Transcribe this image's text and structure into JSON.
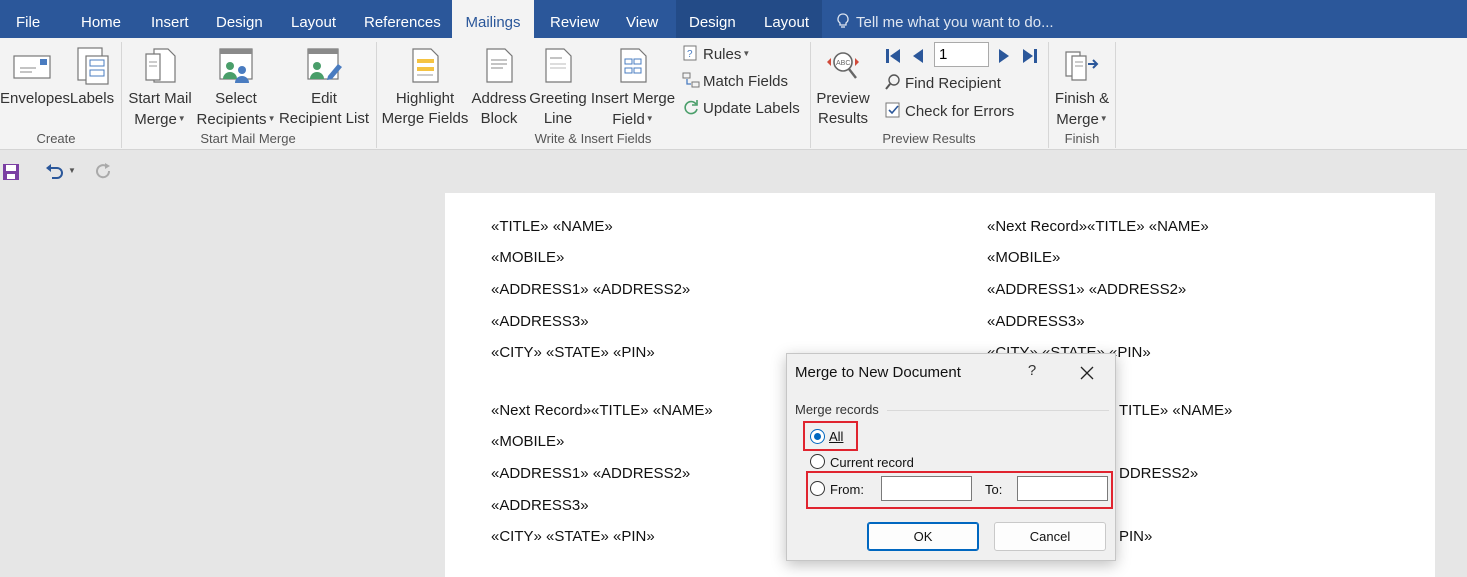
{
  "tabs": {
    "file": "File",
    "home": "Home",
    "insert": "Insert",
    "design": "Design",
    "layout": "Layout",
    "references": "References",
    "mailings": "Mailings",
    "review": "Review",
    "view": "View",
    "ctx_design": "Design",
    "ctx_layout": "Layout",
    "tell_me": "Tell me what you want to do..."
  },
  "ribbon": {
    "create": {
      "envelopes": "Envelopes",
      "labels": "Labels",
      "group": "Create"
    },
    "start_mail_merge": {
      "start_line1": "Start Mail",
      "start_line2": "Merge",
      "select_line1": "Select",
      "select_line2": "Recipients",
      "edit_line1": "Edit",
      "edit_line2": "Recipient List",
      "group": "Start Mail Merge"
    },
    "write_insert": {
      "highlight_line1": "Highlight",
      "highlight_line2": "Merge Fields",
      "address_line1": "Address",
      "address_line2": "Block",
      "greeting_line1": "Greeting",
      "greeting_line2": "Line",
      "insert_line1": "Insert Merge",
      "insert_line2": "Field",
      "rules": "Rules",
      "match_fields": "Match Fields",
      "update_labels": "Update Labels",
      "group": "Write & Insert Fields"
    },
    "preview": {
      "preview_line1": "Preview",
      "preview_line2": "Results",
      "record_number": "1",
      "find_recipient": "Find Recipient",
      "check_errors": "Check for Errors",
      "group": "Preview Results"
    },
    "finish": {
      "finish_line1": "Finish &",
      "finish_line2": "Merge",
      "group": "Finish"
    }
  },
  "document": {
    "left_block1": [
      "«TITLE» «NAME»",
      "«MOBILE»",
      "«ADDRESS1» «ADDRESS2»",
      "«ADDRESS3»",
      "«CITY» «STATE» «PIN»"
    ],
    "left_block2": [
      "«Next Record»«TITLE» «NAME»",
      "«MOBILE»",
      "«ADDRESS1» «ADDRESS2»",
      "«ADDRESS3»",
      "«CITY» «STATE» «PIN»"
    ],
    "right_block1": [
      "«Next Record»«TITLE» «NAME»",
      "«MOBILE»",
      "«ADDRESS1» «ADDRESS2»",
      "«ADDRESS3»",
      "«CITY» «STATE» «PIN»"
    ],
    "right_block2_visible": [
      "TITLE» «NAME»",
      "DDRESS2»",
      "PIN»"
    ]
  },
  "dialog": {
    "title": "Merge to New Document",
    "help": "?",
    "merge_records_label": "Merge records",
    "all": "All",
    "current_record": "Current record",
    "from": "From:",
    "to": "To:",
    "from_value": "",
    "to_value": "",
    "ok": "OK",
    "cancel": "Cancel",
    "selected_option": "All",
    "highlight_color": "#e0242f"
  },
  "colors": {
    "tab_bar": "#2b579a",
    "ribbon": "#f3f3f3",
    "accent": "#0067c0"
  }
}
